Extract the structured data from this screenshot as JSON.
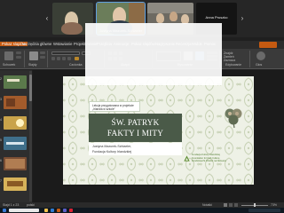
{
  "video": {
    "participants": [
      {
        "name": ""
      },
      {
        "name": "Justyna Mazurek-Schlaeler"
      },
      {
        "name": ""
      },
      {
        "name": "Anna Pruszko"
      }
    ]
  },
  "menu": {
    "items": [
      "Pokaz slajdów",
      "Narzędzia główne",
      "Wstawianie",
      "Projektowanie",
      "Przejścia",
      "Animacje",
      "Pokaz slajdów",
      "Nagrywanie",
      "Recenzja",
      "Widok",
      "Pomoc"
    ]
  },
  "ribbon": {
    "groups": [
      "Schowek",
      "Slajdy",
      "Czcionka",
      "Akapit",
      "Rysowanie",
      "Edytowanie",
      "Głos"
    ],
    "buttons": [
      "Wklej",
      "Nowy slajd",
      "Znajdź",
      "Zamień",
      "Zaznacz",
      "Dyktuj"
    ]
  },
  "thumbnails": {
    "numbers": [
      "2",
      "3",
      "4",
      "5",
      "6",
      "7"
    ],
    "colors": [
      "#5b7a4b",
      "#a35b2b",
      "#c9a34a",
      "#3f6f8a",
      "#7a4e34",
      "#d7b35a"
    ]
  },
  "slide": {
    "top_line_1": "Lekcja przygotowana w projekcie",
    "top_line_2": "„Irlandia w szkole”",
    "title_line_1": "ŚW. PATRYK",
    "title_line_2": "FAKTY I MITY",
    "author_line_1": "Justyna Mazurek-Schlaeler,",
    "author_line_2": "Fundacja Kultury Irlandzkiej",
    "org_line_1": "Fundacja Kultury Irlandzkiej",
    "org_line_2": "Foundation for Irish Culture",
    "org_line_3": "Fondúireacht Chultúr na hÉireann",
    "accent_color": "#4a5a48",
    "shamrock_color": "#6e7a60"
  },
  "statusbar": {
    "left": "Slajd 1 z 23",
    "language": "polski",
    "notes": "Notatki",
    "zoom": "73%"
  }
}
